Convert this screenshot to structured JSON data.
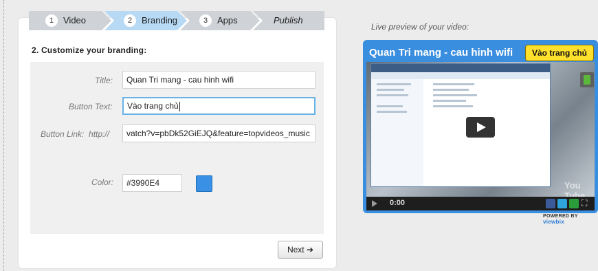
{
  "steps": [
    {
      "num": "1",
      "label": "Video"
    },
    {
      "num": "2",
      "label": "Branding"
    },
    {
      "num": "3",
      "label": "Apps"
    },
    {
      "num": "",
      "label": "Publish"
    }
  ],
  "section_title": "2. Customize your branding:",
  "form": {
    "title_label": "Title:",
    "title_value": "Quan Tri mang - cau hinh wifi",
    "button_text_label": "Button Text:",
    "button_text_value": "Vào trang chủ",
    "button_link_label": "Button Link:  http://",
    "button_link_value": "vatch?v=pbDk52GiEJQ&feature=topvideos_music",
    "color_label": "Color:",
    "color_value": "#3990E4"
  },
  "next_label": "Next ➔",
  "preview": {
    "label": "Live preview of your video:",
    "title": "Quan Tri mang - cau hinh wifi",
    "button": "Vào trang chủ",
    "time": "0:00",
    "youtube_mark": "You Tube",
    "powered_prefix": "POWERED BY",
    "powered_brand": "viewbix"
  },
  "colors": {
    "active_step": "#b7d9f4",
    "swatch": "#3990E4",
    "player_bg": "#3a8ee0",
    "player_button": "#ffe02c"
  }
}
